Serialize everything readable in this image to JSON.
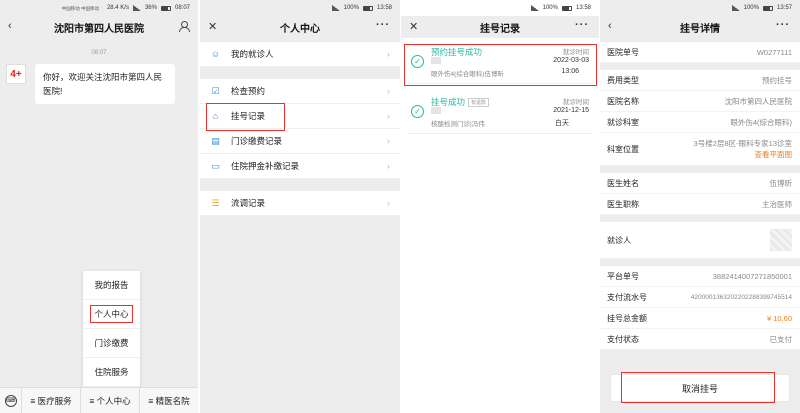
{
  "panel1": {
    "status": {
      "carrier": "中国移动 中国移动",
      "speed": "28.4 K/s",
      "battery": "36%",
      "time": "08:07"
    },
    "nav": {
      "back": "‹",
      "title": "沈阳市第四人民医院"
    },
    "chat": {
      "time": "08:07",
      "avatar_logo": "4+",
      "message": "你好，欢迎关注沈阳市第四人民医院!"
    },
    "popup": {
      "items": [
        "我的报告",
        "个人中心",
        "门诊缴费",
        "住院服务"
      ]
    },
    "bottom": {
      "tabs": [
        "≡ 医疗服务",
        "≡ 个人中心",
        "≡ 精医名院"
      ]
    }
  },
  "panel2": {
    "status": {
      "battery": "100%",
      "time": "13:58"
    },
    "nav": {
      "close": "✕",
      "title": "个人中心",
      "more": "···"
    },
    "groups": [
      [
        {
          "icon": "people-icon",
          "label": "我的就诊人"
        }
      ],
      [
        {
          "icon": "check-icon",
          "label": "检查预约"
        },
        {
          "icon": "tag-icon",
          "label": "挂号记录"
        },
        {
          "icon": "bill-icon",
          "label": "门诊缴费记录"
        },
        {
          "icon": "bed-icon",
          "label": "住院押金补缴记录"
        }
      ],
      [
        {
          "icon": "flow-icon",
          "label": "流调记录"
        }
      ]
    ]
  },
  "panel3": {
    "status": {
      "battery": "100%",
      "time": "13:58"
    },
    "nav": {
      "close": "✕",
      "title": "挂号记录",
      "more": "···"
    },
    "records": [
      {
        "title": "预约挂号成功",
        "tag": "",
        "dept": "眼外伤4(综合眼科)伍博昕",
        "time_label": "就诊时间",
        "date": "2022-03-03",
        "time": "13:06"
      },
      {
        "title": "挂号成功",
        "tag": "有退款",
        "dept": "核酸检测门诊|冯伟",
        "time_label": "就诊时间",
        "date": "2021-12-15",
        "time": "白天"
      }
    ]
  },
  "panel4": {
    "status": {
      "battery": "100%",
      "time": "13:57"
    },
    "nav": {
      "back": "‹",
      "title": "挂号详情",
      "more": "···"
    },
    "group1": [
      {
        "k": "医院单号",
        "v": "W0277111"
      }
    ],
    "group2": [
      {
        "k": "费用类型",
        "v": "预约挂号"
      },
      {
        "k": "医院名称",
        "v": "沈阳市第四人民医院"
      },
      {
        "k": "就诊科室",
        "v": "眼外伤4(综合眼科)"
      }
    ],
    "location": {
      "k": "科室位置",
      "v": "3号楼2层8区-眼科专家13诊室",
      "link": "查看平面图"
    },
    "group3": [
      {
        "k": "医生姓名",
        "v": "伍博昕"
      },
      {
        "k": "医生职称",
        "v": "主治医师"
      }
    ],
    "patient": {
      "k": "就诊人"
    },
    "group4": [
      {
        "k": "平台单号",
        "v": "3882414007271850001"
      },
      {
        "k": "支付流水号",
        "v": "4200001363202202288399745514"
      },
      {
        "k": "挂号总金额",
        "v": "¥ 10.60"
      },
      {
        "k": "支付状态",
        "v": "已支付"
      }
    ],
    "cancel": "取消挂号"
  }
}
